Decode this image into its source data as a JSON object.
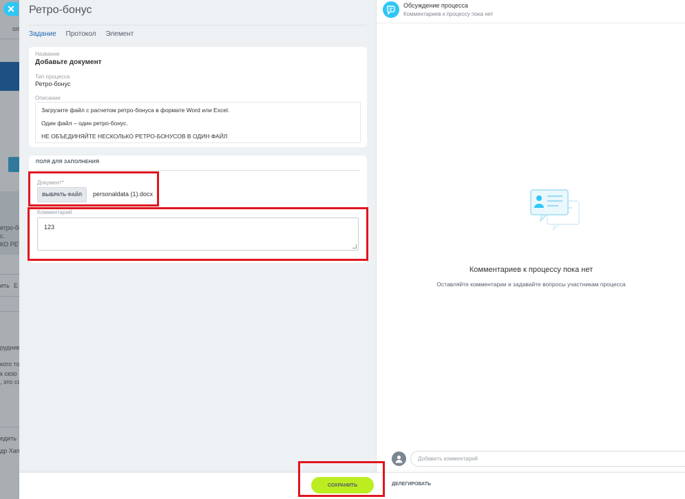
{
  "background": {
    "snippets": [
      "оп",
      "етро-бону",
      "с.",
      "КО РЕТРО",
      "ить",
      "Е",
      "рудника",
      "кого то",
      "к сезо",
      ", это со",
      "едить",
      "др Хапа"
    ]
  },
  "slider": {
    "title": "Ретро-бонус",
    "tabs": [
      {
        "label": "Задание"
      },
      {
        "label": "Протокол"
      },
      {
        "label": "Элемент"
      }
    ],
    "task": {
      "name_label": "Название",
      "name_value": "Добавьте документ",
      "type_label": "Тип процесса",
      "type_value": "Ретро-бонус",
      "desc_label": "Описание",
      "desc_lines": [
        "Загрузите файл с расчетом ретро-бонуса в формате Word или Excel.",
        "Один файл – один ретро-бонус.",
        "НЕ ОБЪЕДИНЯЙТЕ НЕСКОЛЬКО РЕТРО-БОНУСОВ В ОДИН ФАЙЛ"
      ]
    },
    "fields": {
      "section_title": "ПОЛЯ ДЛЯ ЗАПОЛНЕНИЯ",
      "document_label": "Документ*",
      "file_button": "ВЫБРАТЬ ФАЙЛ",
      "file_name": "personaldata (1).docx",
      "comment_label": "Комментарий",
      "comment_value": "123"
    }
  },
  "discussion": {
    "title": "Обсуждение процесса",
    "subtitle": "Комментариев к процессу пока нет",
    "empty_title": "Комментариев к процессу пока нет",
    "empty_subtitle": "Оставляйте комментарии и задавайте вопросы участникам процесса",
    "input_placeholder": "Добавить комментарий"
  },
  "footer": {
    "save_label": "СОХРАНИТЬ",
    "delegate_label": "ДЕЛЕГИРОВАТЬ"
  },
  "colors": {
    "accent": "#2fc6f6",
    "save": "#bbed21",
    "highlight": "#e0141e",
    "tab_active": "#2067b0"
  }
}
